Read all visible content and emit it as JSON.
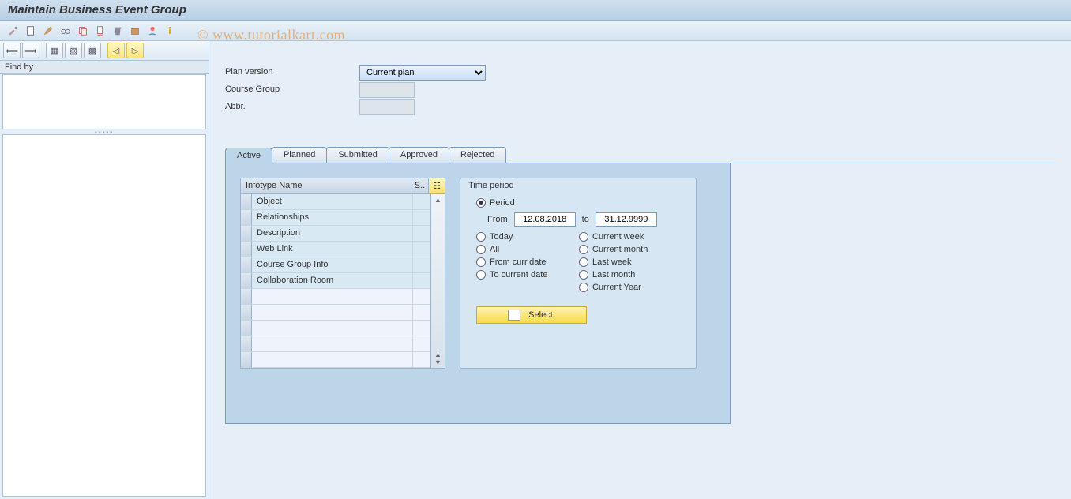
{
  "title": "Maintain Business Event Group",
  "watermark": "©  www.tutorialkart.com",
  "toolbar_icons": [
    "wrench",
    "doc",
    "pencil",
    "glasses",
    "copy",
    "cut",
    "trash",
    "box",
    "person",
    "info"
  ],
  "sidebar": {
    "nav_icons_left": [
      "back",
      "forward"
    ],
    "nav_icons_mid": [
      "tree1",
      "tree2",
      "tree3"
    ],
    "nav_icons_right": [
      "up",
      "down"
    ],
    "find_by_label": "Find by"
  },
  "form": {
    "plan_version_label": "Plan version",
    "plan_version_value": "Current plan",
    "course_group_label": "Course Group",
    "course_group_value": "",
    "abbr_label": "Abbr.",
    "abbr_value": ""
  },
  "tabs": [
    "Active",
    "Planned",
    "Submitted",
    "Approved",
    "Rejected"
  ],
  "active_tab": "Active",
  "infotype_table": {
    "header_name": "Infotype Name",
    "header_s": "S..",
    "rows": [
      "Object",
      "Relationships",
      "Description",
      "Web Link",
      "Course Group Info",
      "Collaboration Room"
    ]
  },
  "time_period": {
    "title": "Time period",
    "period_label": "Period",
    "from_label": "From",
    "from_value": "12.08.2018",
    "to_label": "to",
    "to_value": "31.12.9999",
    "options_left": [
      "Today",
      "All",
      "From curr.date",
      "To current date"
    ],
    "options_right": [
      "Current week",
      "Current month",
      "Last week",
      "Last month",
      "Current Year"
    ],
    "select_button": "Select."
  }
}
